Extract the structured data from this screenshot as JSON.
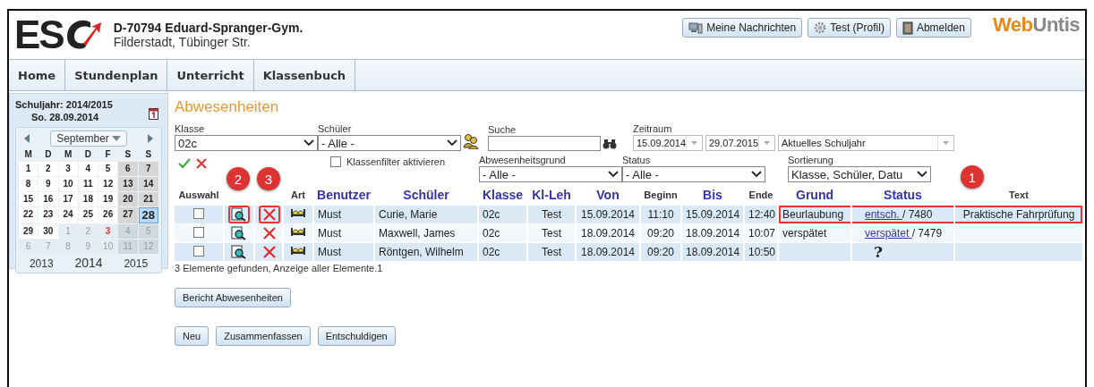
{
  "header": {
    "logo_text": "ES",
    "school_name": "D-70794 Eduard-Spranger-Gym.",
    "school_address": "Filderstadt, Tübinger Str.",
    "buttons": [
      {
        "label": "Meine Nachrichten",
        "kind": "messages"
      },
      {
        "label": "Test (Profil)",
        "kind": "profile"
      },
      {
        "label": "Abmelden",
        "kind": "logout"
      }
    ],
    "brand": {
      "first": "Web",
      "second": "Untis"
    }
  },
  "nav": [
    "Home",
    "Stundenplan",
    "Unterricht",
    "Klassenbuch"
  ],
  "sidebar": {
    "school_year": "Schuljahr: 2014/2015",
    "date": "So. 28.09.2014",
    "month": "September",
    "weekdays": [
      "M",
      "D",
      "M",
      "D",
      "F",
      "S",
      "S"
    ],
    "days": [
      {
        "d": "1",
        "kind": "day",
        "selected": false
      },
      {
        "d": "2",
        "kind": "day",
        "selected": false
      },
      {
        "d": "3",
        "kind": "day",
        "selected": false
      },
      {
        "d": "4",
        "kind": "day",
        "selected": false
      },
      {
        "d": "5",
        "kind": "day",
        "selected": false
      },
      {
        "d": "6",
        "kind": "weekend",
        "selected": false
      },
      {
        "d": "7",
        "kind": "weekend",
        "selected": false
      },
      {
        "d": "8",
        "kind": "day",
        "selected": false
      },
      {
        "d": "9",
        "kind": "day",
        "selected": false
      },
      {
        "d": "10",
        "kind": "day",
        "selected": false
      },
      {
        "d": "11",
        "kind": "day",
        "selected": false
      },
      {
        "d": "12",
        "kind": "day",
        "selected": false
      },
      {
        "d": "13",
        "kind": "weekend",
        "selected": false
      },
      {
        "d": "14",
        "kind": "weekend",
        "selected": false
      },
      {
        "d": "15",
        "kind": "day",
        "selected": false
      },
      {
        "d": "16",
        "kind": "day",
        "selected": false
      },
      {
        "d": "17",
        "kind": "day",
        "selected": false
      },
      {
        "d": "18",
        "kind": "day",
        "selected": false
      },
      {
        "d": "19",
        "kind": "day",
        "selected": false
      },
      {
        "d": "20",
        "kind": "weekend",
        "selected": false
      },
      {
        "d": "21",
        "kind": "weekend",
        "selected": false
      },
      {
        "d": "22",
        "kind": "day",
        "selected": false
      },
      {
        "d": "23",
        "kind": "day",
        "selected": false
      },
      {
        "d": "24",
        "kind": "day",
        "selected": false
      },
      {
        "d": "25",
        "kind": "day",
        "selected": false
      },
      {
        "d": "26",
        "kind": "day",
        "selected": false
      },
      {
        "d": "27",
        "kind": "weekend",
        "selected": false
      },
      {
        "d": "28",
        "kind": "weekend",
        "selected": true
      },
      {
        "d": "29",
        "kind": "day",
        "selected": false
      },
      {
        "d": "30",
        "kind": "day",
        "selected": false
      },
      {
        "d": "1",
        "kind": "other",
        "selected": false
      },
      {
        "d": "2",
        "kind": "other",
        "selected": false
      },
      {
        "d": "3",
        "kind": "holiday",
        "selected": false
      },
      {
        "d": "4",
        "kind": "other-weekend",
        "selected": false
      },
      {
        "d": "5",
        "kind": "other-weekend",
        "selected": false
      },
      {
        "d": "6",
        "kind": "other",
        "selected": false
      },
      {
        "d": "7",
        "kind": "other",
        "selected": false
      },
      {
        "d": "8",
        "kind": "other",
        "selected": false
      },
      {
        "d": "9",
        "kind": "other",
        "selected": false
      },
      {
        "d": "10",
        "kind": "other",
        "selected": false
      },
      {
        "d": "11",
        "kind": "other-weekend",
        "selected": false
      },
      {
        "d": "12",
        "kind": "other-weekend",
        "selected": false
      }
    ],
    "years": [
      {
        "label": "2013",
        "selected": false
      },
      {
        "label": "2014",
        "selected": true
      },
      {
        "label": "2015",
        "selected": false
      }
    ]
  },
  "page_title": "Abwesenheiten",
  "filters": {
    "klasse": {
      "label": "Klasse",
      "value": "02c"
    },
    "schueler": {
      "label": "Schüler",
      "value": "- Alle -"
    },
    "suche": {
      "label": "Suche"
    },
    "zeitraum": {
      "label": "Zeitraum",
      "from": "15.09.2014",
      "to": "29.07.2015",
      "preset": "Aktuelles Schuljahr"
    },
    "klassenfilter": {
      "label": "Klassenfilter aktivieren",
      "checked": false
    },
    "grund": {
      "label": "Abwesenheitsgrund",
      "value": "- Alle -"
    },
    "status": {
      "label": "Status",
      "value": "- Alle -"
    },
    "sortierung": {
      "label": "Sortierung",
      "value": "Klasse, Schüler, Datu"
    }
  },
  "table": {
    "columns": [
      {
        "label": "Auswahl",
        "sortable": false
      },
      {
        "callout": "2"
      },
      {
        "callout": "3"
      },
      {
        "label": "Art",
        "sortable": false
      },
      {
        "label": "Benutzer",
        "sortable": true
      },
      {
        "label": "Schüler",
        "sortable": true
      },
      {
        "label": "Klasse",
        "sortable": true
      },
      {
        "label": "Kl-Leh",
        "sortable": true
      },
      {
        "label": "Von",
        "sortable": true
      },
      {
        "label": "Beginn",
        "sortable": false
      },
      {
        "label": "Bis",
        "sortable": true
      },
      {
        "label": "Ende",
        "sortable": false
      },
      {
        "label": "Grund",
        "sortable": true
      },
      {
        "label": "Status",
        "sortable": true
      },
      {
        "label": "Text",
        "sortable": false,
        "callout": "1"
      }
    ],
    "rows": [
      {
        "checked": false,
        "highlighted": true,
        "user": "Must",
        "student": "Curie, Marie",
        "class": "02c",
        "teacher": "Test",
        "from": "15.09.2014",
        "begin": "11:10",
        "to": "15.09.2014",
        "end": "12:40",
        "reason": "Beurlaubung",
        "kind": "link",
        "status": "entsch. ",
        "status_no": "/ 7480",
        "text": "Praktische Fahrprüfung"
      },
      {
        "checked": false,
        "highlighted": false,
        "user": "Must",
        "student": "Maxwell, James",
        "class": "02c",
        "teacher": "Test",
        "from": "18.09.2014",
        "begin": "09:20",
        "to": "18.09.2014",
        "end": "10:07",
        "reason": "verspätet",
        "kind": "link",
        "status": "verspätet ",
        "status_no": "/ 7479"
      },
      {
        "checked": false,
        "highlighted": false,
        "user": "Must",
        "student": "Röntgen, Wilhelm",
        "class": "02c",
        "teacher": "Test",
        "from": "18.09.2014",
        "begin": "09:20",
        "to": "18.09.2014",
        "end": "10:50",
        "kind": "unknown",
        "status": "?"
      }
    ],
    "summary": "3 Elemente gefunden, Anzeige aller Elemente.1"
  },
  "report_button": "Bericht Abwesenheiten",
  "action_buttons": [
    "Neu",
    "Zusammenfassen",
    "Entschuldigen"
  ]
}
